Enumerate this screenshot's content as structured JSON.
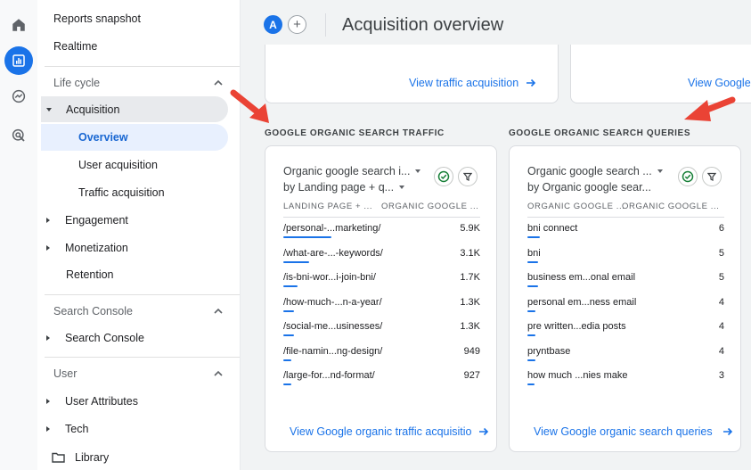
{
  "header": {
    "avatar_letter": "A",
    "plus_glyph": "+",
    "title": "Acquisition overview"
  },
  "rail": {
    "icons": [
      "home-icon",
      "reports-icon",
      "explore-icon",
      "advertising-icon"
    ],
    "active": "reports-icon",
    "accent": "#1a73e8"
  },
  "sidebar": {
    "reports_snapshot": "Reports snapshot",
    "realtime": "Realtime",
    "life_cycle": "Life cycle",
    "acquisition": "Acquisition",
    "overview": "Overview",
    "user_acquisition": "User acquisition",
    "traffic_acquisition": "Traffic acquisition",
    "engagement": "Engagement",
    "monetization": "Monetization",
    "retention": "Retention",
    "search_console_section": "Search Console",
    "search_console": "Search Console",
    "user_section": "User",
    "user_attributes": "User Attributes",
    "tech": "Tech",
    "library": "Library"
  },
  "top_cards": {
    "left_link": "View traffic acquisition",
    "right_link": "View Google"
  },
  "traffic": {
    "section_title": "GOOGLE ORGANIC SEARCH TRAFFIC",
    "selector1": "Organic google search i...",
    "selector2": "by Landing page + q...",
    "col1": "LANDING PAGE + ...",
    "col2": "ORGANIC GOOGLE ...",
    "rows": [
      {
        "label": "/personal-...marketing/",
        "value": "5.9K",
        "share": 1.0
      },
      {
        "label": "/what-are-...-keywords/",
        "value": "3.1K",
        "share": 0.53
      },
      {
        "label": "/is-bni-wor...i-join-bni/",
        "value": "1.7K",
        "share": 0.29
      },
      {
        "label": "/how-much-...n-a-year/",
        "value": "1.3K",
        "share": 0.22
      },
      {
        "label": "/social-me...usinesses/",
        "value": "1.3K",
        "share": 0.22
      },
      {
        "label": "/file-namin...ng-design/",
        "value": "949",
        "share": 0.16
      },
      {
        "label": "/large-for...nd-format/",
        "value": "927",
        "share": 0.16
      }
    ],
    "view_link": "View Google organic traffic acquisition"
  },
  "queries": {
    "section_title": "GOOGLE ORGANIC SEARCH QUERIES",
    "selector1": "Organic google search ...",
    "selector2": "by Organic google sear...",
    "col1": "ORGANIC GOOGLE ...",
    "col2": "ORGANIC GOOGLE ...",
    "rows": [
      {
        "label": "bni connect",
        "value": "6",
        "share": 1.0
      },
      {
        "label": "bni",
        "value": "5",
        "share": 0.83
      },
      {
        "label": "business em...onal email",
        "value": "5",
        "share": 0.83
      },
      {
        "label": "personal em...ness email",
        "value": "4",
        "share": 0.67
      },
      {
        "label": "pre written...edia posts",
        "value": "4",
        "share": 0.67
      },
      {
        "label": "pryntbase",
        "value": "4",
        "share": 0.67
      },
      {
        "label": "how much ...nies make",
        "value": "3",
        "share": 0.5
      }
    ],
    "view_link": "View Google organic search queries"
  },
  "colors": {
    "accent": "#1a73e8",
    "annotation": "#ea4335",
    "selected_bg": "#e8f0fe"
  }
}
